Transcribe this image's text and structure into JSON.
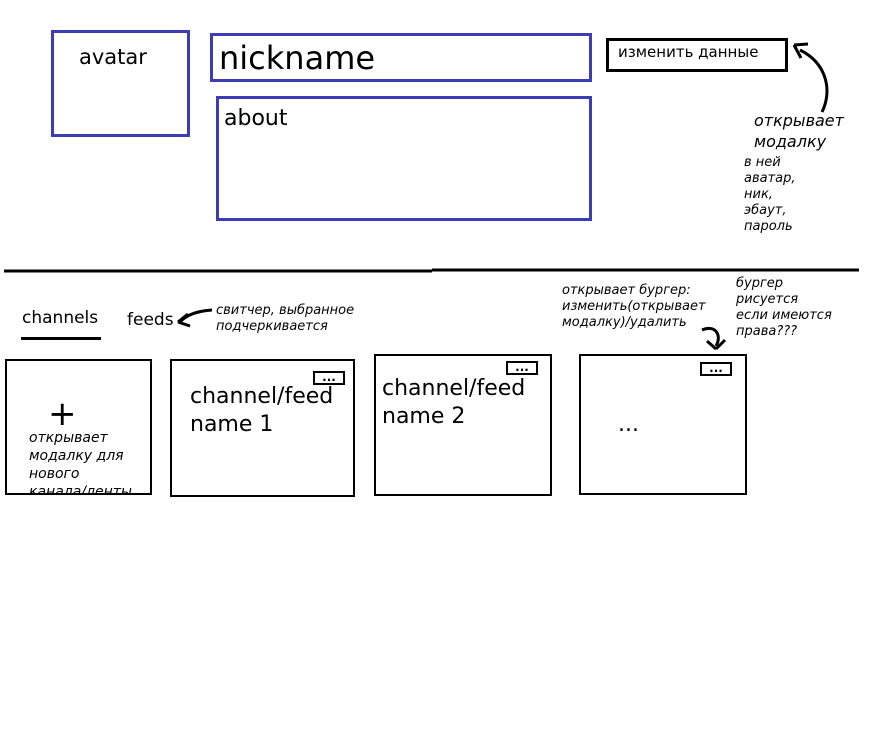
{
  "profile": {
    "avatar_label": "avatar",
    "nickname_label": "nickname",
    "about_label": "about",
    "edit_button_label": "изменить данные"
  },
  "notes": {
    "edit_opens": "открывает\nмодалку",
    "edit_modal_fields": "в ней\nаватар,\nник,\nэбаут,\nпароль",
    "switcher": "свитчер, выбранное\nподчеркивается",
    "burger_opens": "открывает бургер:\nизменить(открывает\nмодалку)/удалить",
    "burger_rights": "бургер\nрисуется\nесли имеются\nправа???",
    "add_card": "открывает\nмодалку для\nнового\nканала/ленты"
  },
  "tabs": [
    {
      "label": "channels",
      "selected": true
    },
    {
      "label": "feeds",
      "selected": false
    }
  ],
  "cards": {
    "add_symbol": "+",
    "card1_name": "channel/feed\nname 1",
    "card2_name": "channel/feed\nname 2",
    "card3_name": "...",
    "burger_label": "..."
  },
  "colors": {
    "profile_border": "#3c3cb4",
    "lines": "#000000"
  }
}
